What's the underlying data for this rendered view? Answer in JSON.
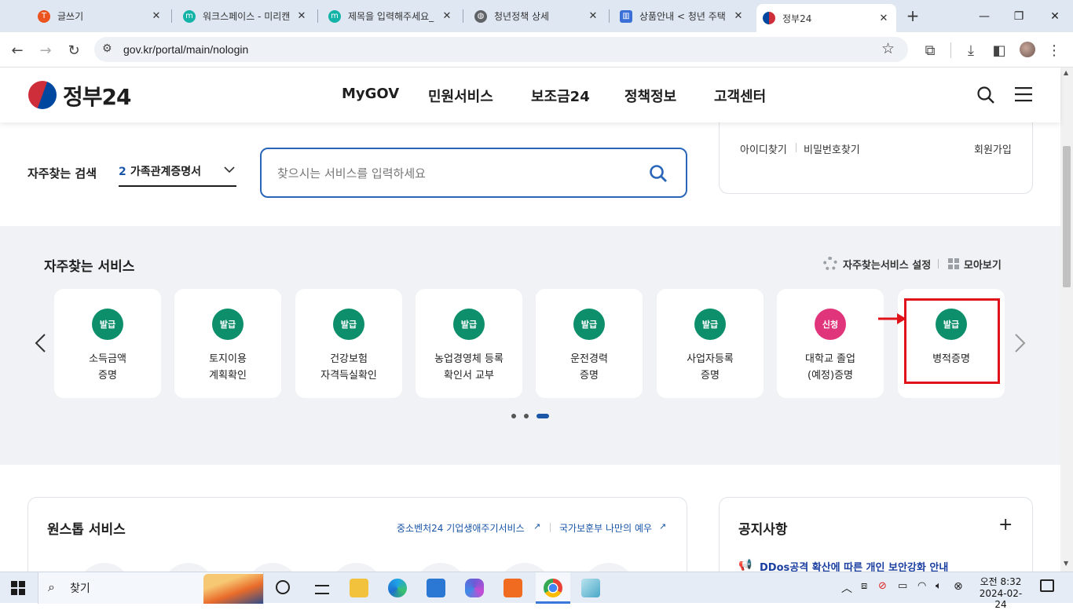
{
  "browser": {
    "tabs": [
      {
        "title": "글쓰기",
        "icon": "tistory-icon",
        "color": "#eb531f"
      },
      {
        "title": "워크스페이스 - 미리캔",
        "icon": "miricanvas-icon",
        "color": "#14b3a8"
      },
      {
        "title": "제목을 입력해주세요_",
        "icon": "miricanvas-icon",
        "color": "#14b3a8"
      },
      {
        "title": "청년정책 상세",
        "icon": "globe-icon",
        "color": "#5f6368"
      },
      {
        "title": "상품안내 < 청년 주택",
        "icon": "bank-icon",
        "color": "#3a6fd8"
      },
      {
        "title": "정부24",
        "icon": "gov24-icon",
        "color": "#cd2e3a"
      }
    ],
    "new_tab_symbol": "+",
    "url": "gov.kr/portal/main/nologin"
  },
  "site": {
    "logo_text": "정부24",
    "nav": [
      "MyGOV",
      "민원서비스",
      "보조금24",
      "정책정보",
      "고객센터"
    ],
    "login_links": {
      "find_id": "아이디찾기",
      "find_pw": "비밀번호찾기",
      "signup": "회원가입"
    },
    "search": {
      "label": "자주찾는 검색",
      "rank": "2",
      "keyword": "가족관계증명서",
      "placeholder": "찾으시는 서비스를 입력하세요"
    },
    "frequent": {
      "title": "자주찾는 서비스",
      "settings_label": "자주찾는서비스 설정",
      "viewall_label": "모아보기",
      "cards": [
        {
          "badge": "발급",
          "label": "소득금액\n증명",
          "badge_color": "#0e8f6b"
        },
        {
          "badge": "발급",
          "label": "토지이용\n계획확인",
          "badge_color": "#0e8f6b"
        },
        {
          "badge": "발급",
          "label": "건강보험\n자격득실확인",
          "badge_color": "#0e8f6b"
        },
        {
          "badge": "발급",
          "label": "농업경영체 등록\n확인서 교부",
          "badge_color": "#0e8f6b"
        },
        {
          "badge": "발급",
          "label": "운전경력\n증명",
          "badge_color": "#0e8f6b"
        },
        {
          "badge": "발급",
          "label": "사업자등록\n증명",
          "badge_color": "#0e8f6b"
        },
        {
          "badge": "신청",
          "label": "대학교 졸업\n(예정)증명",
          "badge_color": "#e0357a"
        },
        {
          "badge": "발급",
          "label": "병적증명",
          "badge_color": "#0e8f6b"
        }
      ],
      "highlight_color": "#e0131a"
    },
    "onestop": {
      "title": "원스톱 서비스",
      "link1": "중소벤처24 기업생애주기서비스",
      "link2": "국가보훈부 나만의 예우"
    },
    "notice": {
      "title": "공지사항",
      "more": "+",
      "first_item": "DDos공격 확산에 따른 개인 보안강화 안내"
    }
  },
  "taskbar": {
    "search_label": "찾기",
    "time": "오전 8:32",
    "date": "2024-02-24"
  }
}
